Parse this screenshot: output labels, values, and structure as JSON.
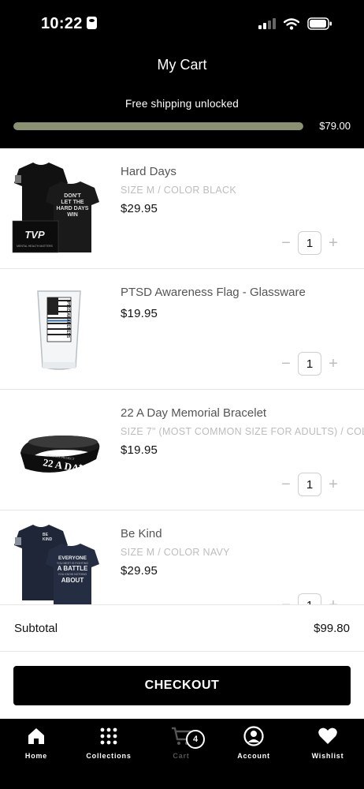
{
  "status_bar": {
    "time": "10:22"
  },
  "header": {
    "title": "My Cart",
    "shipping_message": "Free shipping unlocked",
    "free_shipping_threshold": "$79.00",
    "progress_fraction": 1.0
  },
  "cart": {
    "items": [
      {
        "title": "Hard Days",
        "variant": "SIZE M / COLOR BLACK",
        "price": "$29.95",
        "quantity": "1",
        "image_text": {
          "logo": "TVP",
          "logo_sub": "MENTAL HEALTH MATTERS",
          "slogan": "DON'T LET THE HARD DAYS WIN"
        }
      },
      {
        "title": "PTSD Awareness Flag - Glassware",
        "variant": "",
        "price": "$19.95",
        "quantity": "1",
        "image_text": {
          "glass_print": "PTSD AWARENESS"
        }
      },
      {
        "title": "22 A Day Memorial Bracelet",
        "variant": "SIZE 7\" (MOST COMMON SIZE FOR ADULTS) / COL",
        "price": "$19.95",
        "quantity": "1",
        "image_text": {
          "bracelet": "22 A DAY",
          "bracelet_small": "VETERAN PROJECT"
        }
      },
      {
        "title": "Be Kind",
        "variant": "SIZE M / COLOR NAVY",
        "price": "$29.95",
        "quantity": "1",
        "image_text": {
          "pocket": "BE KIND",
          "slogan": "EVERYONE YOU MEET IS FIGHTING A BATTLE YOU KNOW NOTHING ABOUT"
        }
      }
    ]
  },
  "summary": {
    "subtotal_label": "Subtotal",
    "subtotal_value": "$99.80",
    "checkout_label": "CHECKOUT"
  },
  "tab_bar": {
    "tabs": [
      {
        "label": "Home",
        "icon": "home-icon"
      },
      {
        "label": "Collections",
        "icon": "grid-icon"
      },
      {
        "label": "Cart",
        "icon": "cart-icon"
      },
      {
        "label": "Account",
        "icon": "account-icon"
      },
      {
        "label": "Wishlist",
        "icon": "heart-icon"
      }
    ],
    "cart_count": "4"
  },
  "colors": {
    "header_bg": "#000000",
    "progress_fill": "#8a9170",
    "checkout_bg": "#000000",
    "muted_text": "#bdbdbd"
  }
}
